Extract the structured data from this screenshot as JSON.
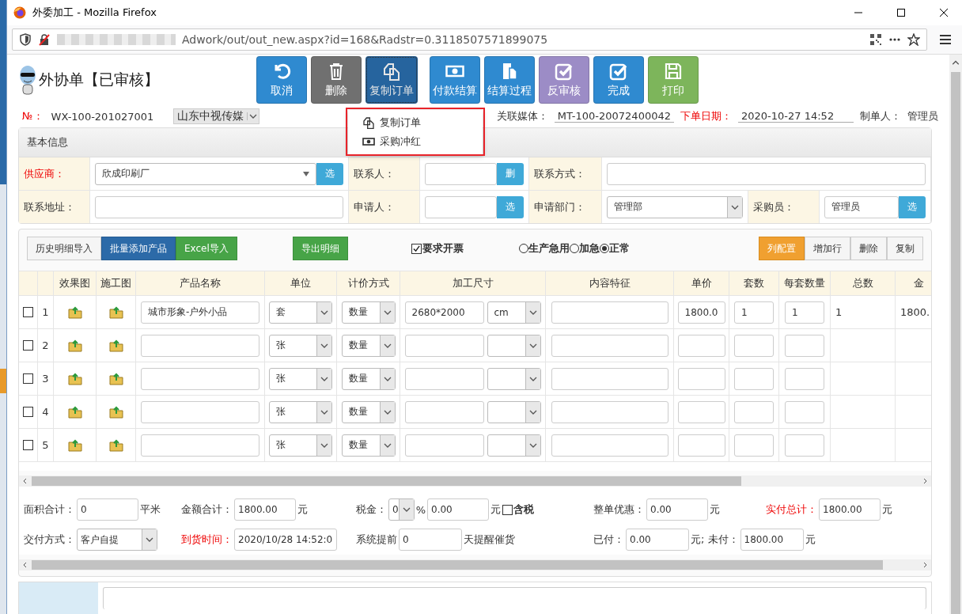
{
  "window": {
    "title": "外委加工 - Mozilla Firefox",
    "url": "Adwork/out/out_new.aspx?id=168&Radstr=0.3118507571899075"
  },
  "header": {
    "title": "外协单【已审核】"
  },
  "toolbar": {
    "buttons": [
      {
        "label": "取消",
        "kind": "undo",
        "color": "#2f8ad0",
        "selected": false
      },
      {
        "label": "删除",
        "kind": "trash",
        "color": "#707070",
        "selected": false
      },
      {
        "label": "复制订单",
        "kind": "copy",
        "color": "#2a6faf",
        "selected": true
      },
      {
        "label": "付款结算",
        "kind": "cash",
        "color": "#2f8ad0",
        "selected": false
      },
      {
        "label": "结算过程",
        "kind": "doc",
        "color": "#2f8ad0",
        "selected": false
      },
      {
        "label": "反审核",
        "kind": "check",
        "color": "#9c8cc6",
        "selected": false
      },
      {
        "label": "完成",
        "kind": "check",
        "color": "#2f8ad0",
        "selected": false
      },
      {
        "label": "打印",
        "kind": "save",
        "color": "#7db55b",
        "selected": false
      }
    ]
  },
  "menu": {
    "items": [
      {
        "label": "复制订单",
        "kind": "copy"
      },
      {
        "label": "采购冲红",
        "kind": "cash"
      }
    ]
  },
  "info": {
    "no_label": "№：",
    "no": "WX-100-201027001",
    "company": "山东中视传媒",
    "fields": [
      {
        "label": "关联媒体：",
        "value": "MT-100-20072400042",
        "required": false
      },
      {
        "label": "下单日期：",
        "value": "2020-10-27 14:52",
        "required": true
      }
    ],
    "maker_label": "制单人：",
    "maker": "管理员"
  },
  "basic_info": {
    "title": "基本信息",
    "rows": [
      [
        {
          "label": "供应商：",
          "required": true,
          "kind": "select-button",
          "value": "欣成印刷厂",
          "button": "选"
        },
        {
          "label": "联系人：",
          "required": false,
          "kind": "input-button",
          "button": "删"
        },
        {
          "label": "联系方式：",
          "required": false,
          "kind": "input"
        }
      ],
      [
        {
          "label": "联系地址：",
          "required": false,
          "kind": "input"
        },
        {
          "label": "申请人：",
          "required": false,
          "kind": "input-button",
          "button": "选"
        },
        {
          "label": "申请部门：",
          "required": false,
          "kind": "select",
          "value": "管理部"
        },
        {
          "label": "采购员：",
          "required": false,
          "kind": "input-button",
          "value": "管理员",
          "button": "选"
        }
      ]
    ]
  },
  "details": {
    "left_buttons": [
      {
        "label": "历史明细导入",
        "kind": "default"
      },
      {
        "label": "批量添加产品",
        "kind": "primary"
      },
      {
        "label": "Excel导入",
        "kind": "success"
      }
    ],
    "export_button": {
      "label": "导出明细",
      "kind": "success"
    },
    "invoice": {
      "label": "要求开票",
      "checked": true
    },
    "urgency": [
      {
        "label": "生产急用",
        "selected": false
      },
      {
        "label": "加急",
        "selected": false
      },
      {
        "label": "正常",
        "selected": true
      }
    ],
    "right_buttons": [
      {
        "label": "列配置",
        "kind": "warning"
      },
      {
        "label": "增加行",
        "kind": "default"
      },
      {
        "label": "删除",
        "kind": "default"
      },
      {
        "label": "复制",
        "kind": "default"
      }
    ],
    "table": {
      "columns": [
        "效果图",
        "施工图",
        "产品名称",
        "单位",
        "计价方式",
        "加工尺寸",
        "内容特征",
        "单价",
        "套数",
        "每套数量",
        "总数",
        "金"
      ],
      "rows": [
        {
          "checked": false,
          "index": "1",
          "name": "城市形象-户外小品",
          "unit": "套",
          "pricing": "数量",
          "size": "2680*2000",
          "size_unit": "cm",
          "price": "1800.0",
          "sets": "1",
          "per_set": "1",
          "total": "1",
          "amount": "1800."
        },
        {
          "checked": false,
          "index": "2",
          "unit": "张",
          "pricing": "数量"
        },
        {
          "checked": false,
          "index": "3",
          "unit": "张",
          "pricing": "数量"
        },
        {
          "checked": false,
          "index": "4",
          "unit": "张",
          "pricing": "数量"
        },
        {
          "checked": false,
          "index": "5",
          "unit": "张",
          "pricing": "数量"
        }
      ]
    },
    "footer": {
      "rows": [
        [
          [
            {
              "kind": "label",
              "text": "面积合计：",
              "required": false
            },
            {
              "kind": "input",
              "value": "0"
            },
            {
              "kind": "text",
              "text": "平米"
            }
          ],
          [
            {
              "kind": "label",
              "text": "金额合计：",
              "required": false
            },
            {
              "kind": "input",
              "value": "1800.00"
            },
            {
              "kind": "text",
              "text": "元"
            }
          ],
          [
            {
              "kind": "label",
              "text": "税金：",
              "required": false
            },
            {
              "kind": "select",
              "value": "0"
            },
            {
              "kind": "text",
              "text": "%"
            },
            {
              "kind": "input",
              "value": "0.00"
            },
            {
              "kind": "text",
              "text": "元"
            },
            {
              "kind": "checkbox",
              "text": "含税",
              "checked": false
            }
          ],
          [
            {
              "kind": "label",
              "text": "整单优惠：",
              "required": false
            },
            {
              "kind": "input",
              "value": "0.00"
            },
            {
              "kind": "text",
              "text": "元"
            }
          ],
          [
            {
              "kind": "label",
              "text": "实付总计：",
              "required": true
            },
            {
              "kind": "input",
              "value": "1800.00"
            },
            {
              "kind": "text",
              "text": "元"
            }
          ]
        ],
        [
          [
            {
              "kind": "label",
              "text": "交付方式：",
              "required": false
            },
            {
              "kind": "select",
              "value": "客户自提"
            }
          ],
          [
            {
              "kind": "label",
              "text": "到货时间：",
              "required": true
            },
            {
              "kind": "datetime",
              "value": "2020/10/28 14:52:0"
            }
          ],
          [
            {
              "kind": "label",
              "text": "系统提前",
              "required": false
            },
            {
              "kind": "small",
              "value": "0"
            },
            {
              "kind": "text",
              "text": "天提醒催货"
            }
          ],
          [
            {
              "kind": "label",
              "text": "已付：",
              "required": false
            },
            {
              "kind": "small",
              "value": "0.00"
            },
            {
              "kind": "text",
              "text": "元; 未付："
            },
            {
              "kind": "small",
              "value": "1800.00"
            },
            {
              "kind": "text",
              "text": "元"
            }
          ]
        ]
      ]
    }
  }
}
